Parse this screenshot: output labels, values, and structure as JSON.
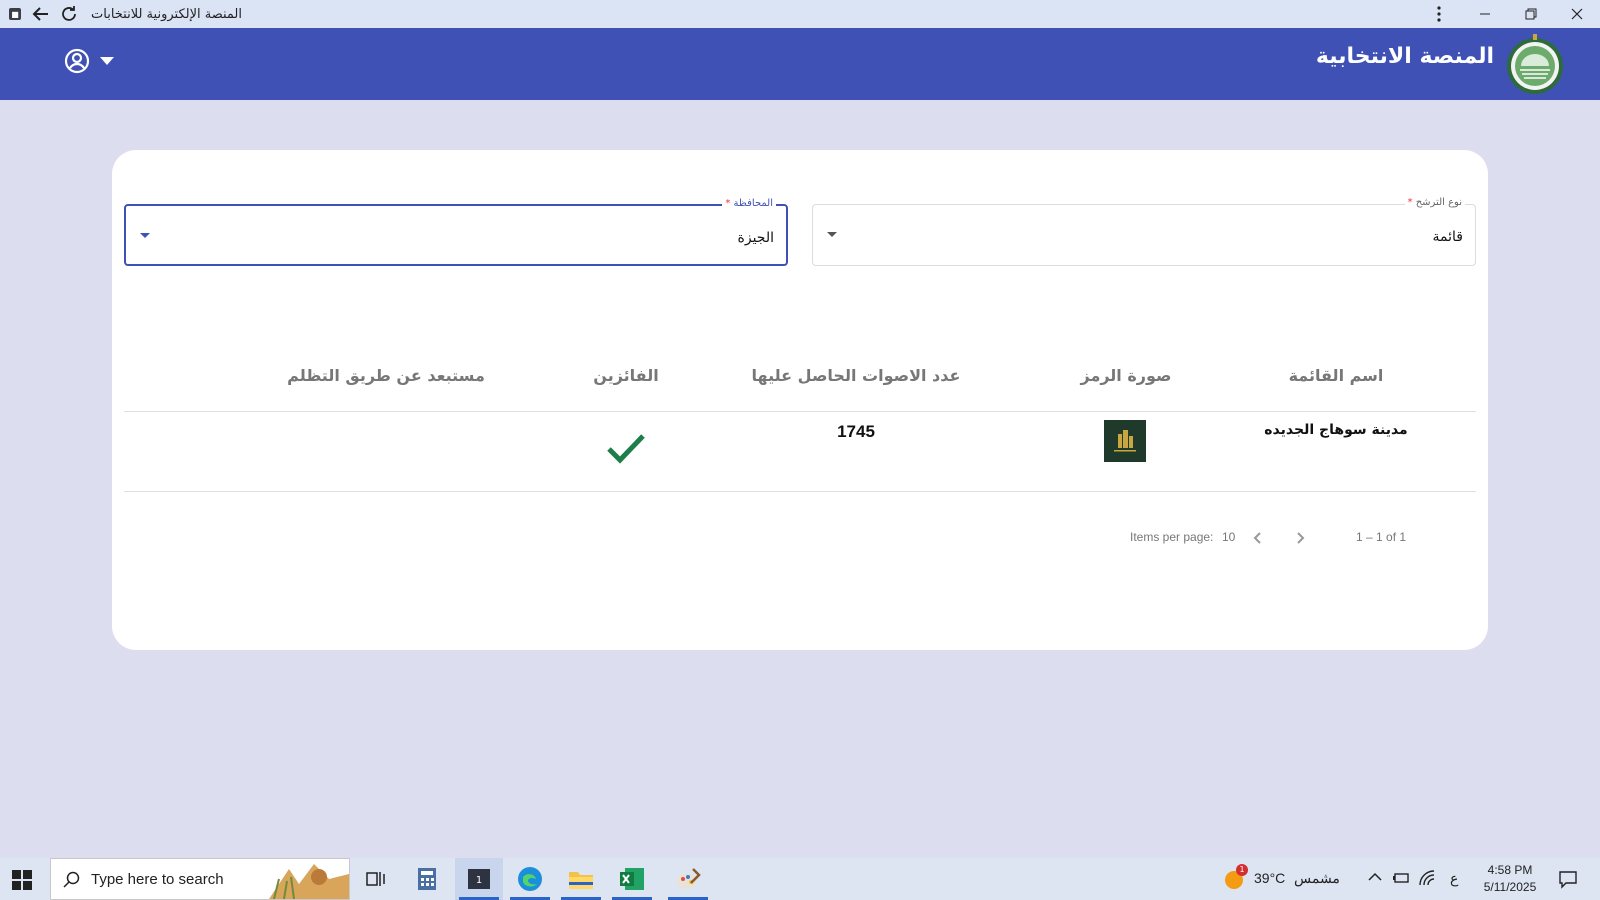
{
  "window": {
    "title": "المنصة الإلكترونية للانتخابات"
  },
  "header": {
    "title": "المنصة الانتخابية"
  },
  "filters": {
    "candidacy_type": {
      "label": "نوع الترشح",
      "required_mark": "*",
      "value": "قائمة"
    },
    "governorate": {
      "label": "المحافظة",
      "required_mark": "*",
      "value": "الجيزة"
    }
  },
  "table": {
    "columns": [
      "اسم القائمة",
      "صورة الرمز",
      "عدد الاصوات الحاصل عليها",
      "الفائزين",
      "مستبعد عن طريق التظلم"
    ],
    "rows": [
      {
        "list_name": "مدينة سوهاج الجديده",
        "votes": "1745",
        "winner": true,
        "excluded": ""
      }
    ]
  },
  "paginator": {
    "items_per_page_label": "Items per page:",
    "items_per_page_value": "10",
    "range": "1 – 1 of 1"
  },
  "taskbar": {
    "search_placeholder": "Type here to search",
    "weather_temp": "39°C",
    "weather_desc": "مشمس",
    "weather_badge": "1",
    "lang": "ع",
    "time": "4:58 PM",
    "date": "5/11/2025"
  },
  "colors": {
    "primary": "#3f51b5",
    "check_green": "#1e7e4a",
    "page_bg": "#dcdef0"
  }
}
